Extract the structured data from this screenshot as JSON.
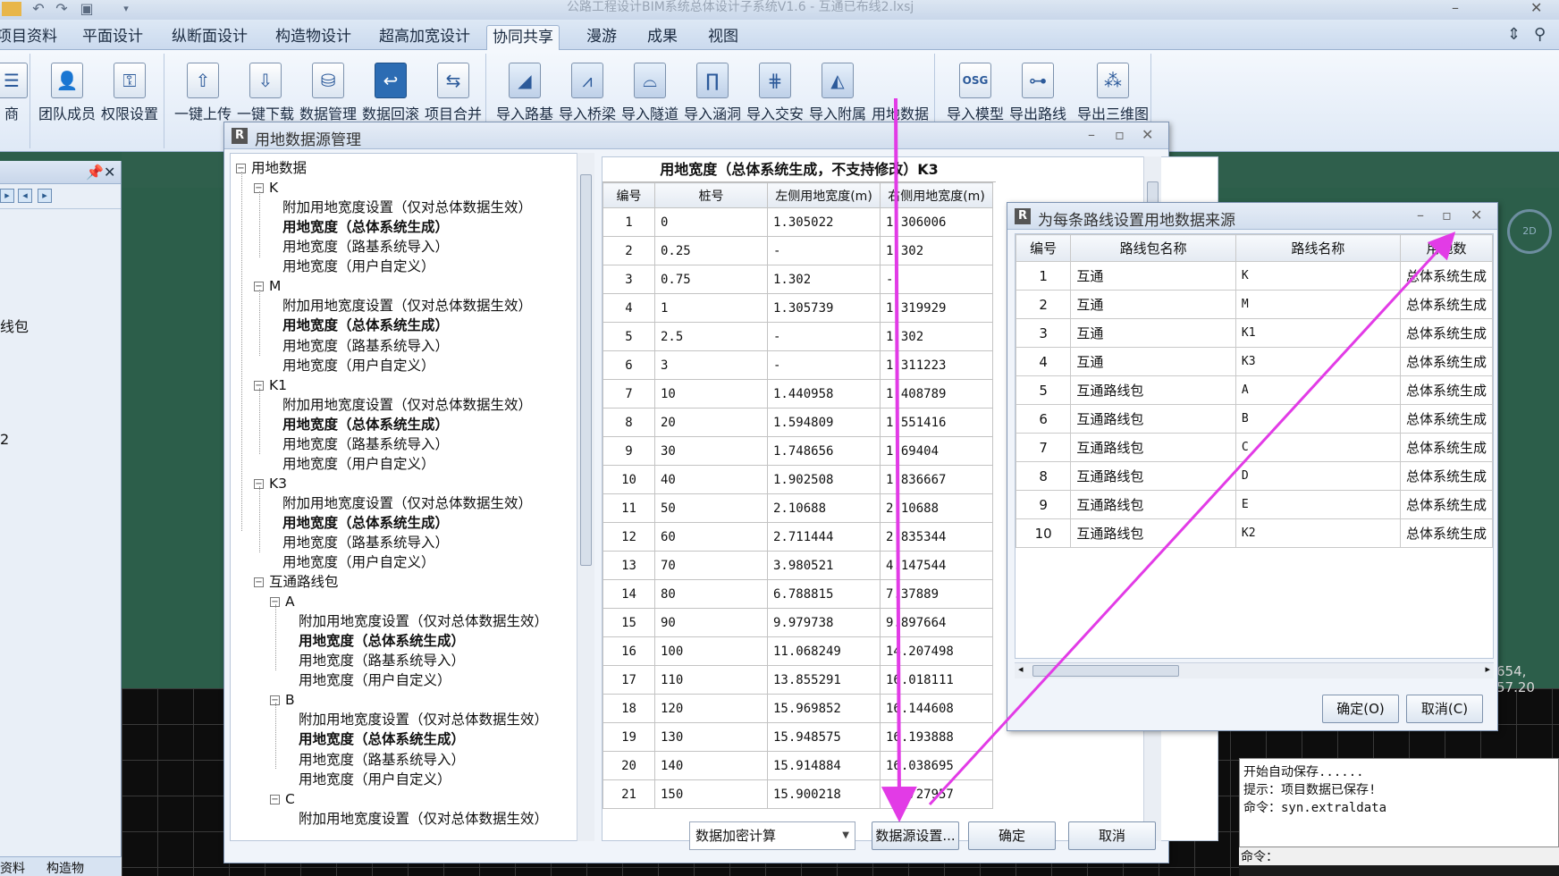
{
  "window": {
    "title": "公路工程设计BIM系统总体设计子系统V1.6 - 互通已布线2.lxsj",
    "minimize_glyph": "–",
    "close_glyph": "✕"
  },
  "menu_tabs": [
    "项目资料",
    "平面设计",
    "纵断面设计",
    "构造物设计",
    "超高加宽设计",
    "协同共享",
    "漫游",
    "成果",
    "视图"
  ],
  "active_tab": "协同共享",
  "ribbon": {
    "group1": [
      "商"
    ],
    "group2": [
      "团队成员",
      "权限设置"
    ],
    "group3": [
      "一键上传",
      "一键下载",
      "数据管理",
      "数据回滚",
      "项目合并"
    ],
    "group4": [
      "导入路基",
      "导入桥梁",
      "导入隧道",
      "导入涵洞",
      "导入交安",
      "导入附属",
      "用地数据"
    ],
    "group5": [
      "导入模型",
      "导出路线",
      "导出三维图"
    ]
  },
  "left_panel": {
    "pin": "📌",
    "close": "✕",
    "visible_text": [
      "线包",
      "2"
    ],
    "bottom_tabs": [
      "资料",
      "构造物"
    ]
  },
  "data_source_dialog": {
    "title": "用地数据源管理",
    "tree": {
      "root": "用地数据",
      "groups": [
        {
          "name": "K",
          "items": [
            "附加用地宽度设置（仅对总体数据生效）",
            "用地宽度（总体系统生成）",
            "用地宽度（路基系统导入）",
            "用地宽度（用户自定义）"
          ]
        },
        {
          "name": "M",
          "items": [
            "附加用地宽度设置（仅对总体数据生效）",
            "用地宽度（总体系统生成）",
            "用地宽度（路基系统导入）",
            "用地宽度（用户自定义）"
          ]
        },
        {
          "name": "K1",
          "items": [
            "附加用地宽度设置（仅对总体数据生效）",
            "用地宽度（总体系统生成）",
            "用地宽度（路基系统导入）",
            "用地宽度（用户自定义）"
          ]
        },
        {
          "name": "K3",
          "items": [
            "附加用地宽度设置（仅对总体数据生效）",
            "用地宽度（总体系统生成）",
            "用地宽度（路基系统导入）",
            "用地宽度（用户自定义）"
          ]
        }
      ],
      "package": {
        "name": "互通路线包",
        "subgroups": [
          {
            "name": "A",
            "items": [
              "附加用地宽度设置（仅对总体数据生效）",
              "用地宽度（总体系统生成）",
              "用地宽度（路基系统导入）",
              "用地宽度（用户自定义）"
            ]
          },
          {
            "name": "B",
            "items": [
              "附加用地宽度设置（仅对总体数据生效）",
              "用地宽度（总体系统生成）",
              "用地宽度（路基系统导入）",
              "用地宽度（用户自定义）"
            ]
          },
          {
            "name": "C",
            "items": [
              "附加用地宽度设置（仅对总体数据生效）"
            ]
          }
        ]
      }
    },
    "width_table": {
      "caption": "用地宽度（总体系统生成，不支持修改）K3",
      "headers": [
        "编号",
        "桩号",
        "左侧用地宽度(m)",
        "右侧用地宽度(m)"
      ],
      "rows": [
        [
          "1",
          "0",
          "1.305022",
          "1.306006"
        ],
        [
          "2",
          "0.25",
          "-",
          "1.302"
        ],
        [
          "3",
          "0.75",
          "1.302",
          "-"
        ],
        [
          "4",
          "1",
          "1.305739",
          "1.319929"
        ],
        [
          "5",
          "2.5",
          "-",
          "1.302"
        ],
        [
          "6",
          "3",
          "-",
          "1.311223"
        ],
        [
          "7",
          "10",
          "1.440958",
          "1.408789"
        ],
        [
          "8",
          "20",
          "1.594809",
          "1.551416"
        ],
        [
          "9",
          "30",
          "1.748656",
          "1.69404"
        ],
        [
          "10",
          "40",
          "1.902508",
          "1.836667"
        ],
        [
          "11",
          "50",
          "2.10688",
          "2.10688"
        ],
        [
          "12",
          "60",
          "2.711444",
          "2.835344"
        ],
        [
          "13",
          "70",
          "3.980521",
          "4.147544"
        ],
        [
          "14",
          "80",
          "6.788815",
          "7.37889"
        ],
        [
          "15",
          "90",
          "9.979738",
          "9.897664"
        ],
        [
          "16",
          "100",
          "11.068249",
          "14.207498"
        ],
        [
          "17",
          "110",
          "13.855291",
          "16.018111"
        ],
        [
          "18",
          "120",
          "15.969852",
          "16.144608"
        ],
        [
          "19",
          "130",
          "15.948575",
          "16.193888"
        ],
        [
          "20",
          "140",
          "15.914884",
          "16.038695"
        ],
        [
          "21",
          "150",
          "15.900218",
          "15.727957"
        ]
      ]
    },
    "combo_value": "数据加密计算",
    "buttons": {
      "source": "数据源设置...",
      "ok": "确定",
      "cancel": "取消"
    }
  },
  "route_source_dialog": {
    "title": "为每条路线设置用地数据来源",
    "headers": [
      "编号",
      "路线包名称",
      "路线名称",
      "用地数"
    ],
    "rows": [
      [
        "1",
        "互通",
        "K",
        "总体系统生成"
      ],
      [
        "2",
        "互通",
        "M",
        "总体系统生成"
      ],
      [
        "3",
        "互通",
        "K1",
        "总体系统生成"
      ],
      [
        "4",
        "互通",
        "K3",
        "总体系统生成"
      ],
      [
        "5",
        "互通路线包",
        "A",
        "总体系统生成"
      ],
      [
        "6",
        "互通路线包",
        "B",
        "总体系统生成"
      ],
      [
        "7",
        "互通路线包",
        "C",
        "总体系统生成"
      ],
      [
        "8",
        "互通路线包",
        "D",
        "总体系统生成"
      ],
      [
        "9",
        "互通路线包",
        "E",
        "总体系统生成"
      ],
      [
        "10",
        "互通路线包",
        "K2",
        "总体系统生成"
      ]
    ],
    "buttons": {
      "ok": "确定(O)",
      "cancel": "取消(C)"
    }
  },
  "canvas": {
    "coord": "654, 57.20",
    "navcube": "2D"
  },
  "console": {
    "lines": [
      "开始自动保存......",
      "提示：项目数据已保存!",
      "命令：syn.extraldata"
    ],
    "prompt": "命令："
  },
  "colors": {
    "annotation": "#e23be6",
    "accent": "#2c6cb3"
  }
}
